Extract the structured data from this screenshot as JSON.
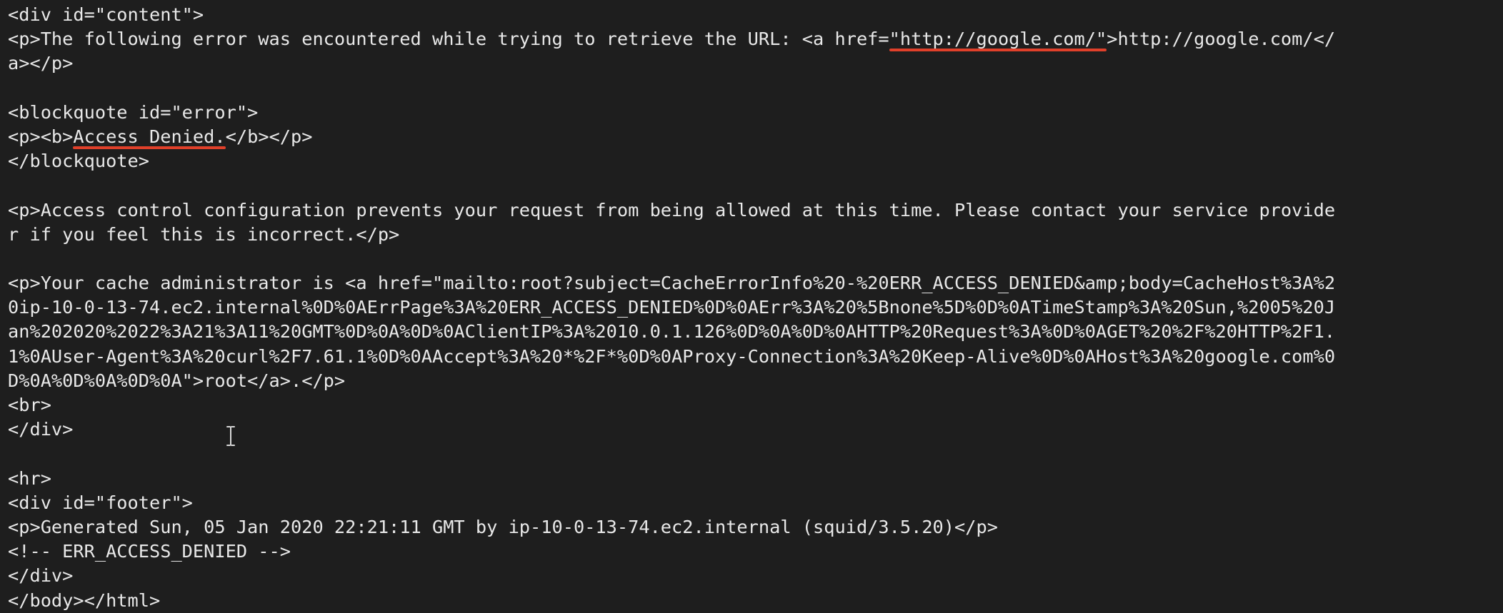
{
  "terminal": {
    "lines": {
      "l1": "<div id=\"content\">",
      "l2a": "<p>The following error was encountered while trying to retrieve the URL: <a href=",
      "l2b": "\"http://google.com/\"",
      "l2c": ">http://google.com/</",
      "l3": "a></p>",
      "l5": "<blockquote id=\"error\">",
      "l6a": "<p><b>",
      "l6b": "Access Denied.",
      "l6c": "</b></p>",
      "l7": "</blockquote>",
      "l9": "<p>Access control configuration prevents your request from being allowed at this time. Please contact your service provide",
      "l10": "r if you feel this is incorrect.</p>",
      "l12": "<p>Your cache administrator is <a href=\"mailto:root?subject=CacheErrorInfo%20-%20ERR_ACCESS_DENIED&amp;body=CacheHost%3A%2",
      "l13": "0ip-10-0-13-74.ec2.internal%0D%0AErrPage%3A%20ERR_ACCESS_DENIED%0D%0AErr%3A%20%5Bnone%5D%0D%0ATimeStamp%3A%20Sun,%2005%20J",
      "l14": "an%202020%2022%3A21%3A11%20GMT%0D%0A%0D%0AClientIP%3A%2010.0.1.126%0D%0A%0D%0AHTTP%20Request%3A%0D%0AGET%20%2F%20HTTP%2F1.",
      "l15": "1%0AUser-Agent%3A%20curl%2F7.61.1%0D%0AAccept%3A%20*%2F*%0D%0AProxy-Connection%3A%20Keep-Alive%0D%0AHost%3A%20google.com%0",
      "l16": "D%0A%0D%0A%0D%0A\">root</a>.</p>",
      "l17": "<br>",
      "l18": "</div>",
      "l20": "<hr>",
      "l21": "<div id=\"footer\">",
      "l22": "<p>Generated Sun, 05 Jan 2020 22:21:11 GMT by ip-10-0-13-74.ec2.internal (squid/3.5.20)</p>",
      "l23": "<!-- ERR_ACCESS_DENIED -->",
      "l24": "</div>",
      "l25": "</body></html>"
    },
    "colors": {
      "background": "#1e1e1e",
      "text": "#e8e8e8",
      "highlight_underline": "#e0402a"
    },
    "cursor_icon": "text-cursor-ibeam-icon"
  }
}
